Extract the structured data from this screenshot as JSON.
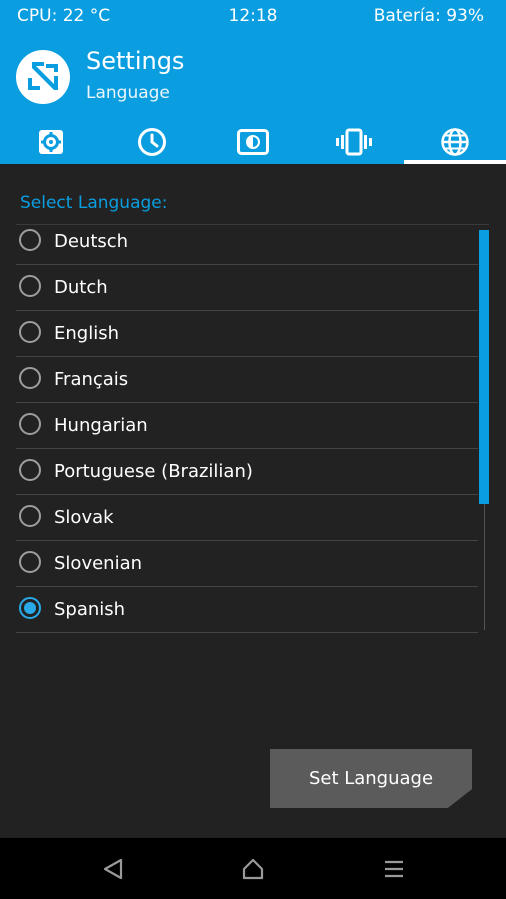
{
  "status_bar": {
    "cpu": "CPU: 22 °C",
    "time": "12:18",
    "battery": "Batería: 93%"
  },
  "header": {
    "logo_icon": "twrp-logo-icon",
    "title": "Settings",
    "subtitle": "Language"
  },
  "tabs": [
    {
      "icon": "gear-icon",
      "active": false
    },
    {
      "icon": "clock-icon",
      "active": false
    },
    {
      "icon": "brightness-icon",
      "active": false
    },
    {
      "icon": "vibrate-icon",
      "active": false
    },
    {
      "icon": "globe-icon",
      "active": true
    }
  ],
  "language_panel": {
    "label": "Select Language:",
    "languages": [
      {
        "name": "Deutsch",
        "selected": false
      },
      {
        "name": "Dutch",
        "selected": false
      },
      {
        "name": "English",
        "selected": false
      },
      {
        "name": "Français",
        "selected": false
      },
      {
        "name": "Hungarian",
        "selected": false
      },
      {
        "name": "Portuguese (Brazilian)",
        "selected": false
      },
      {
        "name": "Slovak",
        "selected": false
      },
      {
        "name": "Slovenian",
        "selected": false
      },
      {
        "name": "Spanish",
        "selected": true
      }
    ]
  },
  "actions": {
    "set_language_label": "Set Language"
  },
  "nav_bar": {
    "icons": [
      "back-icon",
      "home-icon",
      "menu-icon"
    ]
  },
  "colors": {
    "accent": "#0a9ee0",
    "background": "#222222",
    "button": "#5b5b5b"
  }
}
